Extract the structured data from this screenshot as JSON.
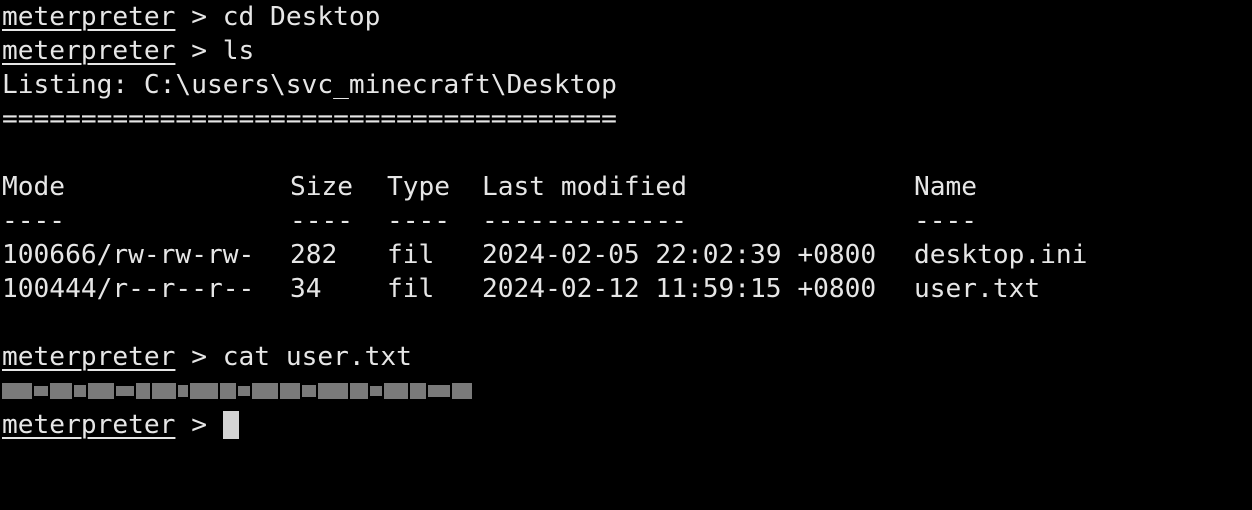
{
  "terminal": {
    "prompt": "meterpreter",
    "separator": " > ",
    "commands": {
      "cd": "cd Desktop",
      "ls": "ls",
      "cat": "cat user.txt"
    },
    "listing_header": "Listing: C:\\users\\svc_minecraft\\Desktop",
    "listing_rule": "=======================================",
    "columns": {
      "mode": "Mode",
      "size": "Size",
      "type": "Type",
      "last_modified": "Last modified",
      "name": "Name"
    },
    "column_dashes": {
      "mode": "----",
      "size": "----",
      "type": "----",
      "last_modified": "-------------",
      "name": "----"
    },
    "rows": [
      {
        "mode": "100666/rw-rw-rw-",
        "size": "282",
        "type": "fil",
        "last_modified": "2024-02-05 22:02:39 +0800",
        "name": "desktop.ini"
      },
      {
        "mode": "100444/r--r--r--",
        "size": "34",
        "type": "fil",
        "last_modified": "2024-02-12 11:59:15 +0800",
        "name": "user.txt"
      }
    ],
    "colors": {
      "background": "#000000",
      "text": "#e6e6e6",
      "cursor": "#d4d4d4",
      "redaction": "#7a7a7a"
    }
  }
}
